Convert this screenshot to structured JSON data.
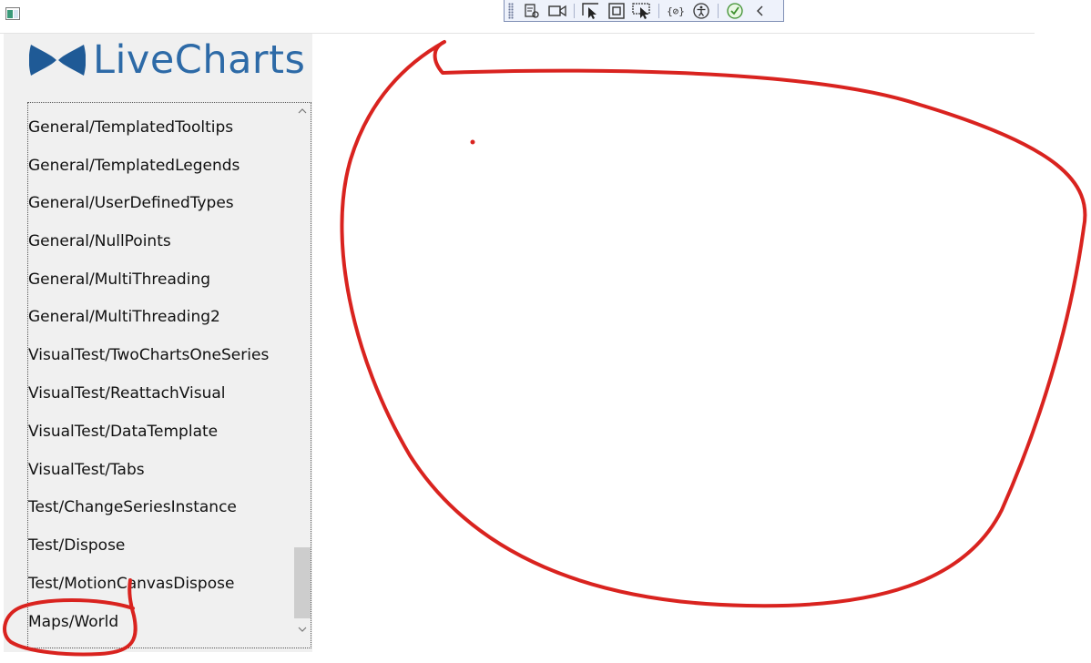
{
  "app": {
    "logo_text": "LiveCharts"
  },
  "colors": {
    "brand": "#2d6aa7",
    "annotation": "#d9231f",
    "sidebar_bg": "#f0f0f0"
  },
  "toolbar": {
    "buttons": [
      {
        "icon": "select-element-icon"
      },
      {
        "icon": "camera-icon"
      },
      {
        "icon": "pointer-select-icon"
      },
      {
        "icon": "display-layout-adorners-icon"
      },
      {
        "icon": "track-focus-icon"
      },
      {
        "icon": "binding-failures-icon"
      },
      {
        "icon": "accessibility-icon"
      },
      {
        "icon": "checkmark-icon"
      },
      {
        "icon": "collapse-icon"
      }
    ]
  },
  "sidebar": {
    "items": [
      {
        "label": "General/TemplatedTooltips"
      },
      {
        "label": "General/TemplatedLegends"
      },
      {
        "label": "General/UserDefinedTypes"
      },
      {
        "label": "General/NullPoints"
      },
      {
        "label": "General/MultiThreading"
      },
      {
        "label": "General/MultiThreading2"
      },
      {
        "label": "VisualTest/TwoChartsOneSeries"
      },
      {
        "label": "VisualTest/ReattachVisual"
      },
      {
        "label": "VisualTest/DataTemplate"
      },
      {
        "label": "VisualTest/Tabs"
      },
      {
        "label": "Test/ChangeSeriesInstance"
      },
      {
        "label": "Test/Dispose"
      },
      {
        "label": "Test/MotionCanvasDispose"
      },
      {
        "label": "Maps/World"
      }
    ]
  }
}
